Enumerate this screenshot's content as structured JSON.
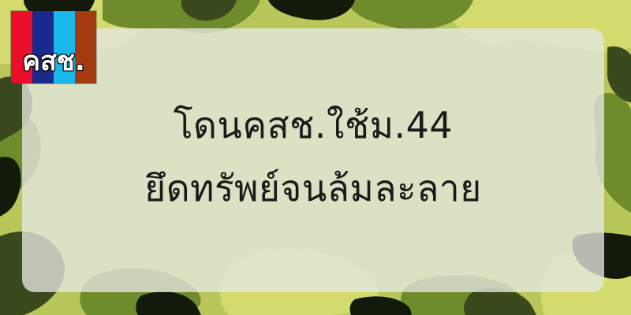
{
  "background": {
    "pattern": "camouflage",
    "colors": [
      "#b9c65a",
      "#d4db6e",
      "#6f8b2c",
      "#3b4a1c",
      "#121a0c"
    ]
  },
  "panel": {
    "color": "#e4e8e0"
  },
  "logo": {
    "text": "คสช.",
    "stripe_colors": [
      "#e8102a",
      "#1a2a8c",
      "#19b8e8",
      "#a33a10"
    ]
  },
  "headline": {
    "line1": "โดนคสช.ใช้ม.44",
    "line2": "ยึดทรัพย์จนล้มละลาย",
    "color": "#1a1a1a"
  }
}
